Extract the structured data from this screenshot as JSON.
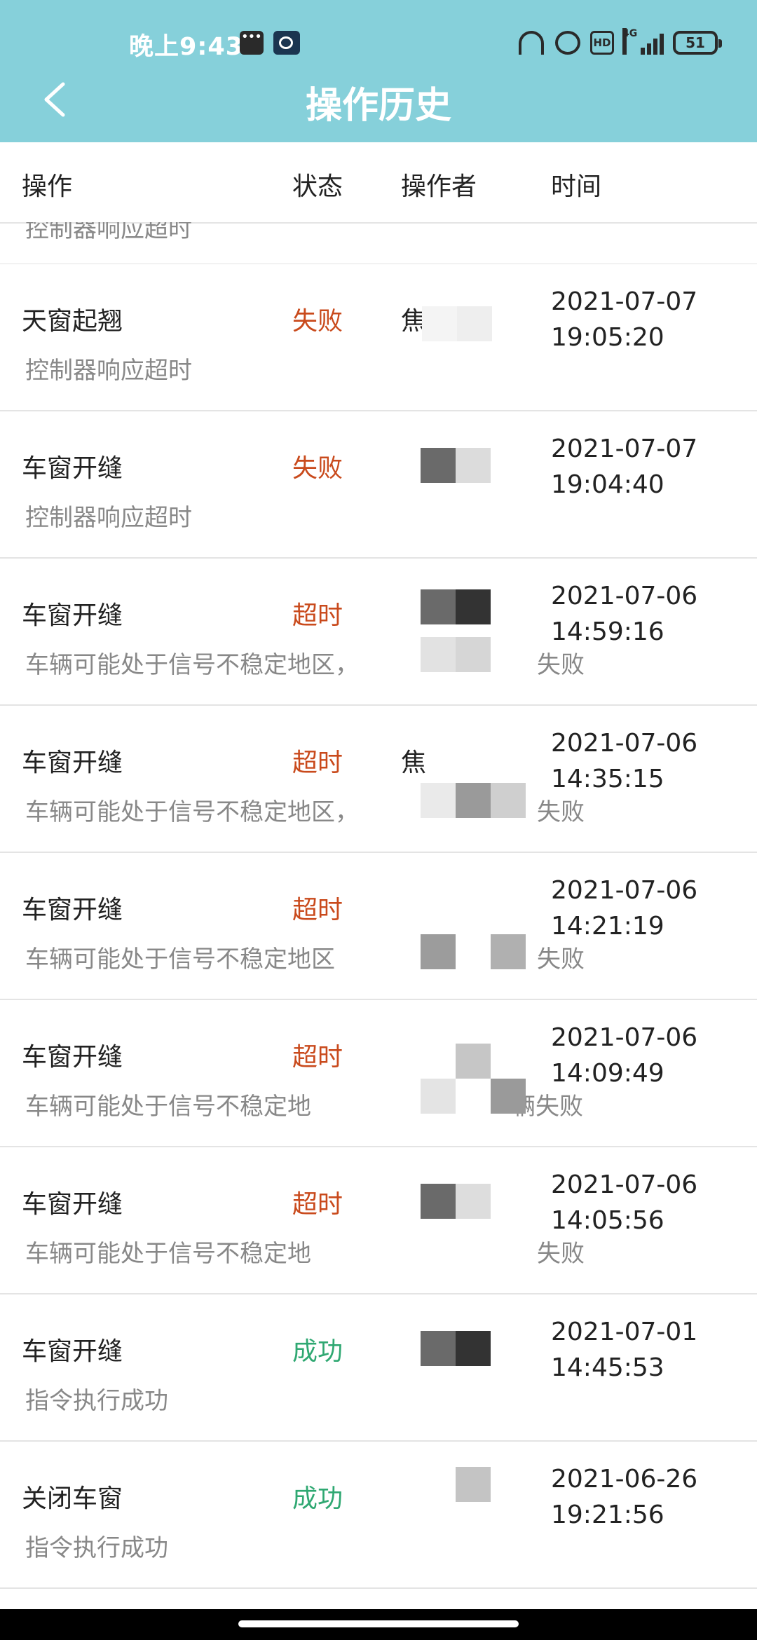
{
  "status_bar": {
    "time": "晚上9:43",
    "network": "4G",
    "battery": "51"
  },
  "header": {
    "title": "操作历史"
  },
  "columns": {
    "operation": "操作",
    "status": "状态",
    "operator": "操作者",
    "time": "时间"
  },
  "partial_row": {
    "message": "控制器响应超时"
  },
  "rows": [
    {
      "op": "天窗起翘",
      "status": "失败",
      "operator": "焦",
      "date": "2021-07-07",
      "clock": "19:05:20",
      "message": "控制器响应超时",
      "message_tail": ""
    },
    {
      "op": "车窗开缝",
      "status": "失败",
      "operator": "",
      "date": "2021-07-07",
      "clock": "19:04:40",
      "message": "控制器响应超时",
      "message_tail": ""
    },
    {
      "op": "车窗开缝",
      "status": "超时",
      "operator": "",
      "date": "2021-07-06",
      "clock": "14:59:16",
      "message": "车辆可能处于信号不稳定地区，",
      "message_tail": "失败"
    },
    {
      "op": "车窗开缝",
      "status": "超时",
      "operator": "焦",
      "date": "2021-07-06",
      "clock": "14:35:15",
      "message": "车辆可能处于信号不稳定地区，",
      "message_tail": "失败"
    },
    {
      "op": "车窗开缝",
      "status": "超时",
      "operator": "",
      "date": "2021-07-06",
      "clock": "14:21:19",
      "message": "车辆可能处于信号不稳定地区",
      "message_tail": "失败"
    },
    {
      "op": "车窗开缝",
      "status": "超时",
      "operator": "",
      "date": "2021-07-06",
      "clock": "14:09:49",
      "message": "车辆可能处于信号不稳定地",
      "message_tail": "辆失败"
    },
    {
      "op": "车窗开缝",
      "status": "超时",
      "operator": "",
      "date": "2021-07-06",
      "clock": "14:05:56",
      "message": "车辆可能处于信号不稳定地",
      "message_tail": "失败"
    },
    {
      "op": "车窗开缝",
      "status": "成功",
      "operator": "",
      "date": "2021-07-01",
      "clock": "14:45:53",
      "message": "指令执行成功",
      "message_tail": ""
    },
    {
      "op": "关闭车窗",
      "status": "成功",
      "operator": "",
      "date": "2021-06-26",
      "clock": "19:21:56",
      "message": "指令执行成功",
      "message_tail": ""
    }
  ],
  "colors": {
    "header_bg": "#86d0da",
    "status_fail": "#c94a1c",
    "status_success": "#2fa872"
  }
}
